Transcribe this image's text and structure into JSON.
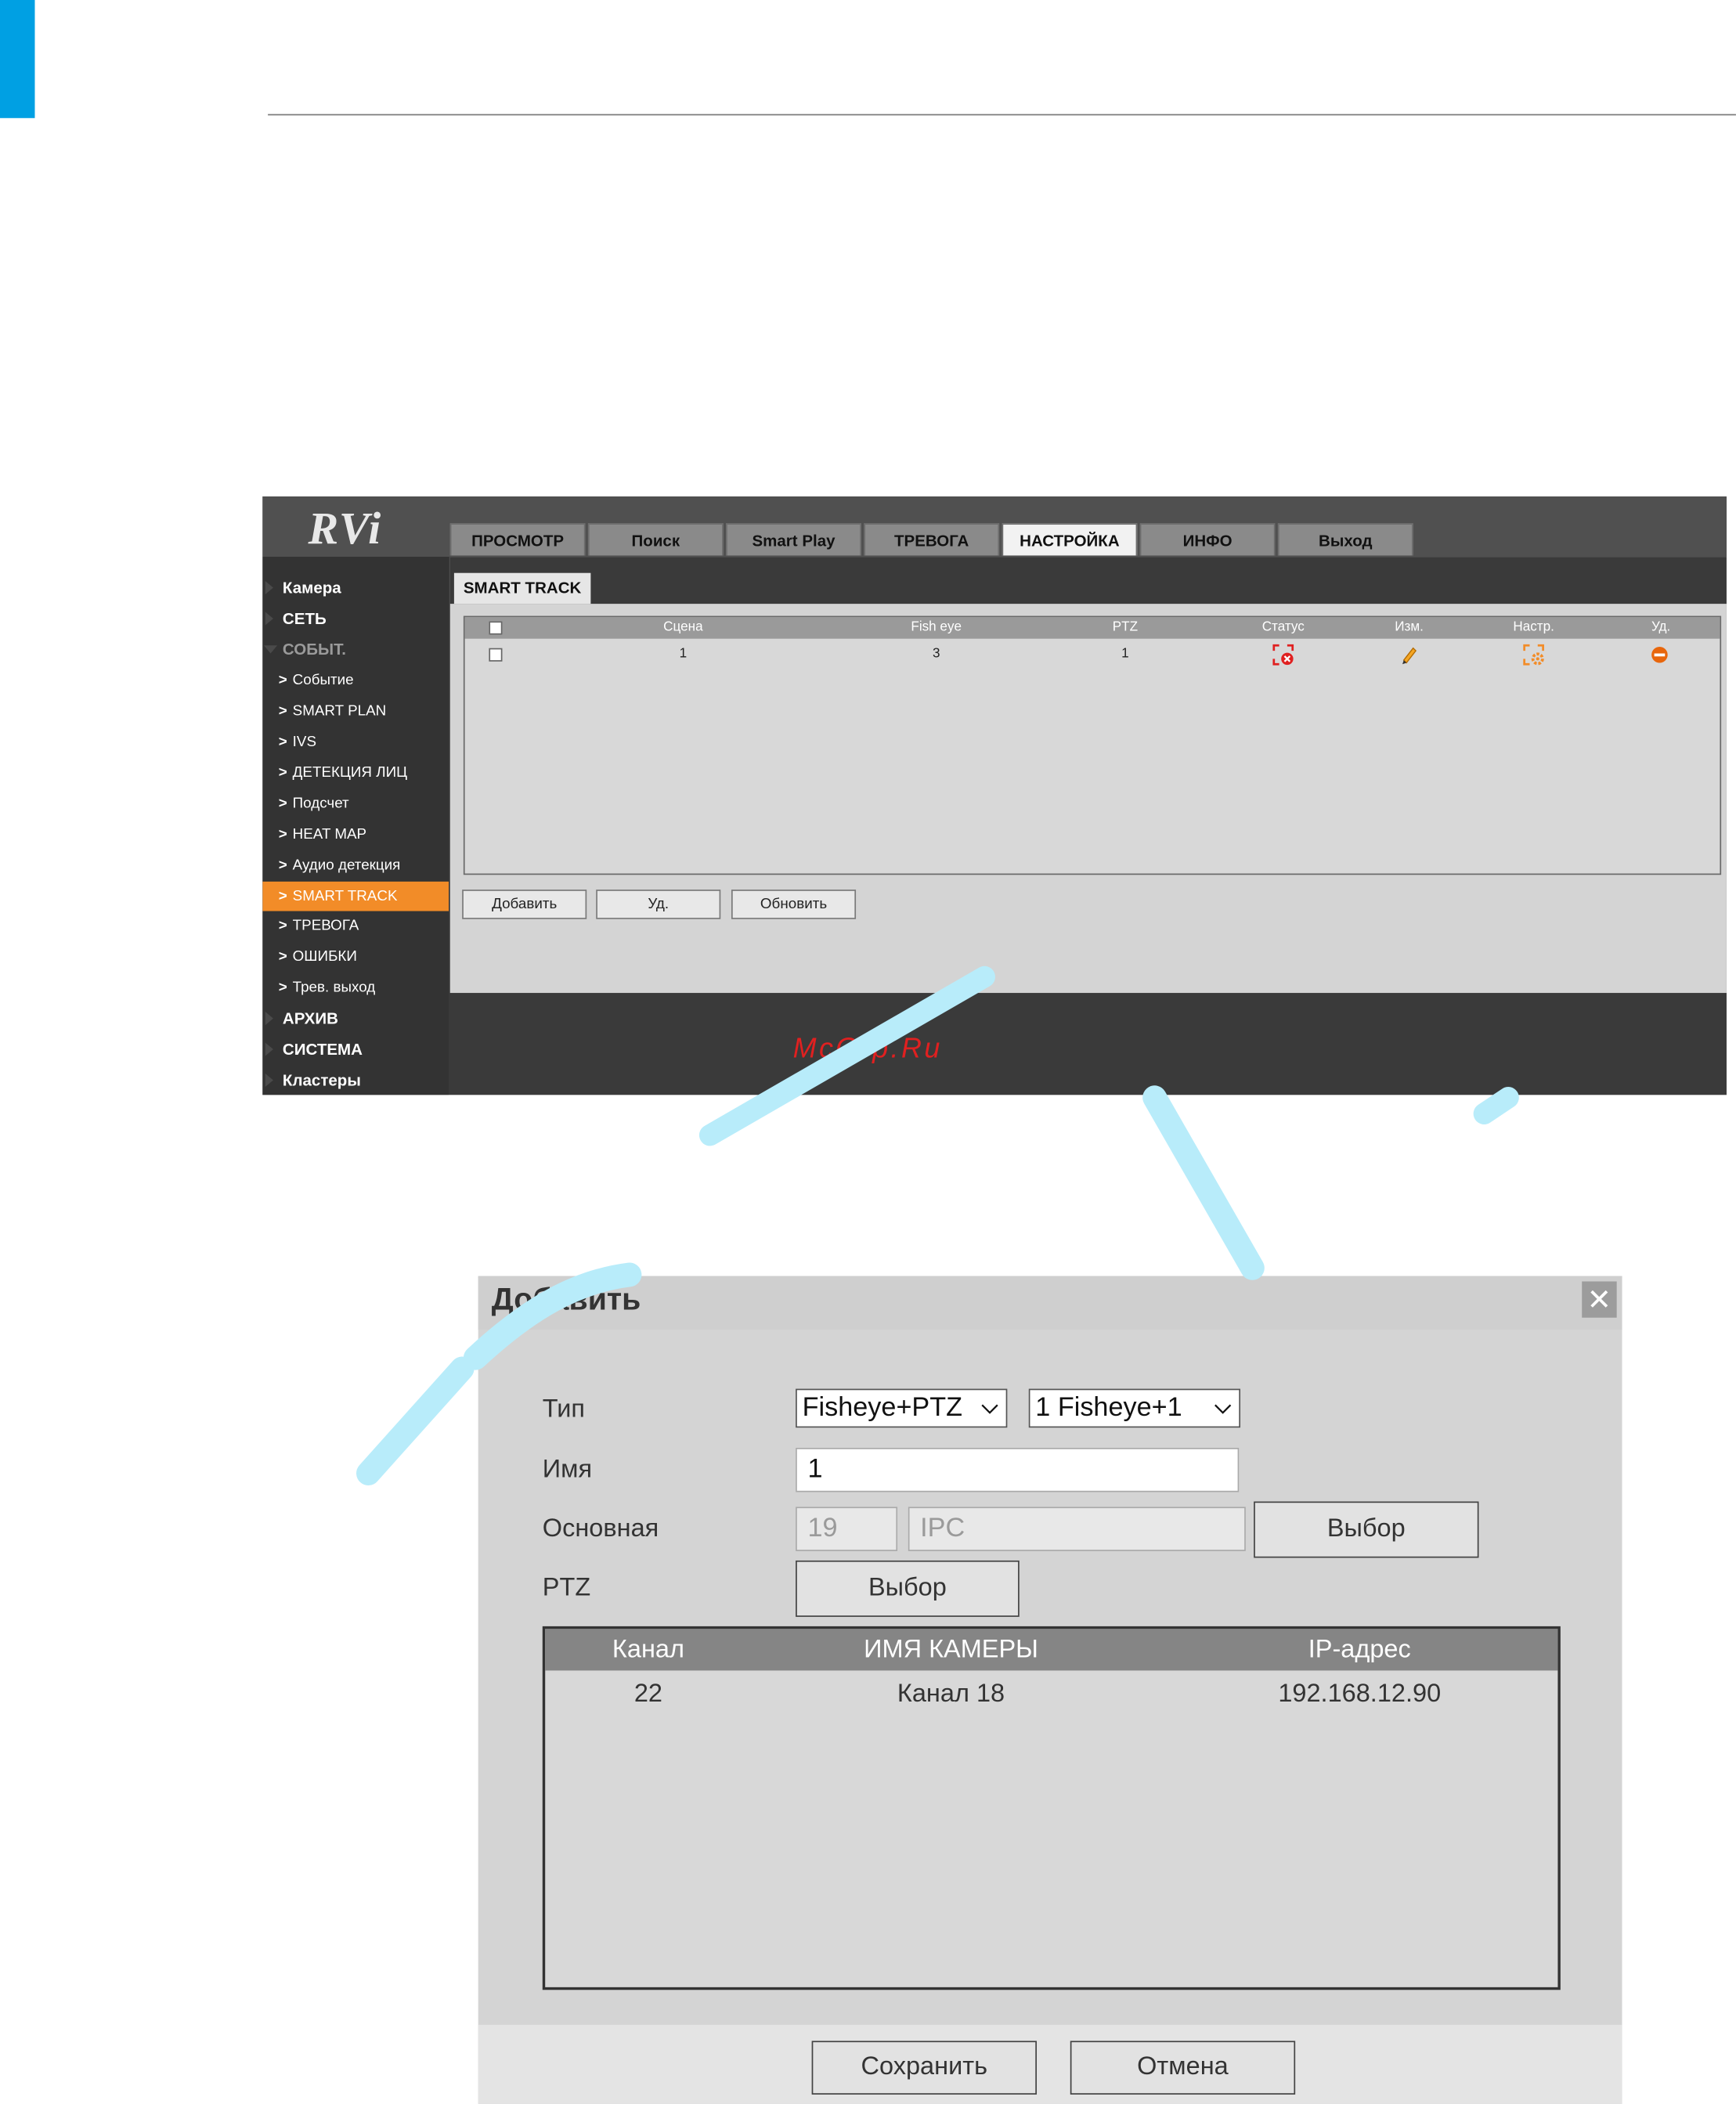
{
  "logo": "RVi",
  "nav_tabs": [
    "ПРОСМОТР",
    "Поиск",
    "Smart Play",
    "ТРЕВОГА",
    "НАСТРОЙКА",
    "ИНФО",
    "Выход"
  ],
  "active_tab": "НАСТРОЙКА",
  "sidebar": {
    "items": [
      {
        "label": "Камера"
      },
      {
        "label": "СЕТЬ"
      },
      {
        "label": "СОБЫТ."
      },
      {
        "label": "Событие"
      },
      {
        "label": "SMART PLAN"
      },
      {
        "label": "IVS"
      },
      {
        "label": "ДЕТЕКЦИЯ ЛИЦ"
      },
      {
        "label": "Подсчет"
      },
      {
        "label": "HEAT MAP"
      },
      {
        "label": "Аудио детекция"
      },
      {
        "label": "SMART TRACK"
      },
      {
        "label": "ТРЕВОГА"
      },
      {
        "label": "ОШИБКИ"
      },
      {
        "label": "Трев. выход"
      },
      {
        "label": "АРХИВ"
      },
      {
        "label": "СИСТЕМА"
      },
      {
        "label": "Кластеры"
      }
    ]
  },
  "page_tab": "SMART TRACK",
  "grid": {
    "columns": [
      "Сцена",
      "Fish eye",
      "PTZ",
      "Статус",
      "Изм.",
      "Настр.",
      "Уд."
    ],
    "rows": [
      {
        "scene": "1",
        "fisheye": "3",
        "ptz": "1",
        "status_icon": "status-error-icon",
        "edit_icon": "edit-pencil-icon",
        "settings_icon": "settings-gear-icon",
        "delete_icon": "delete-minus-icon"
      }
    ]
  },
  "grid_buttons": {
    "add": "Добавить",
    "delete": "Уд.",
    "refresh": "Обновить"
  },
  "site_watermark": "McGrp.Ru",
  "dialog": {
    "title": "Добавить",
    "close": "✕",
    "type_label": "Тип",
    "type_value": "Fisheye+PTZ",
    "mode_value": "1 Fisheye+1",
    "name_label": "Имя",
    "name_value": "1",
    "main_label": "Основная",
    "main_channel": "19",
    "main_type": "IPC",
    "main_select": "Выбор",
    "ptz_label": "PTZ",
    "ptz_select": "Выбор",
    "table": {
      "headers": [
        "Канал",
        "ИМЯ КАМЕРЫ",
        "IP-адрес"
      ],
      "rows": [
        {
          "channel": "22",
          "name": "Канал 18",
          "ip": "192.168.12.90"
        }
      ]
    },
    "save": "Сохранить",
    "cancel": "Отмена"
  },
  "colors": {
    "accent_blue": "#00a0e3",
    "active_orange": "#f28c28",
    "status_red": "#e02020"
  }
}
